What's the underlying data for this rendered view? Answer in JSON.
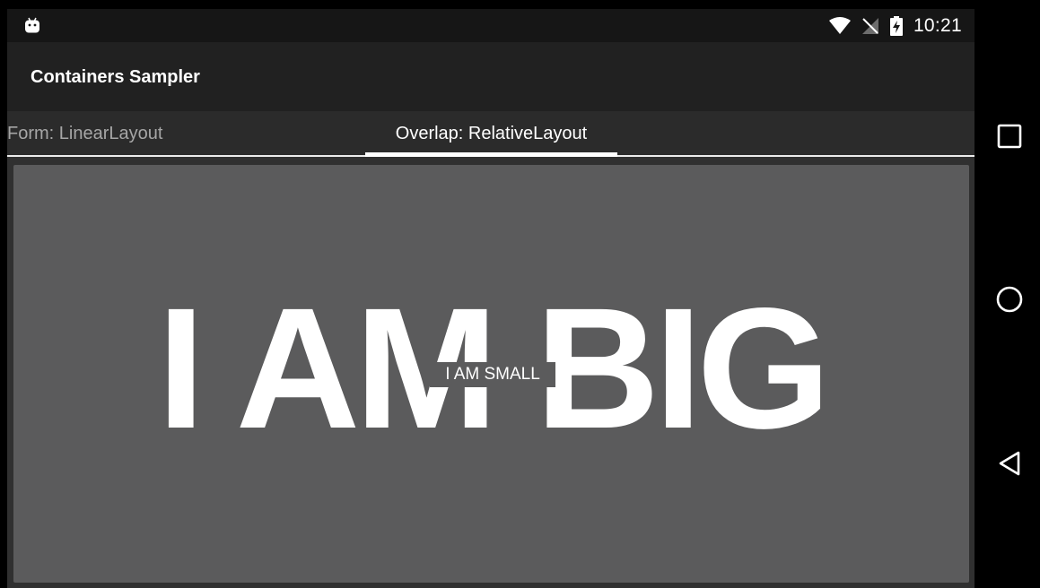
{
  "status_bar": {
    "time": "10:21",
    "icons": [
      "android-debug-icon",
      "wifi-icon",
      "no-sim-icon",
      "battery-charging-icon"
    ]
  },
  "app_bar": {
    "title": "Containers Sampler"
  },
  "tabs": [
    {
      "label": "Form: LinearLayout",
      "selected": false
    },
    {
      "label": "Overlap: RelativeLayout",
      "selected": true
    }
  ],
  "content": {
    "big_label": "I AM BIG",
    "small_label": "I AM SMALL"
  },
  "nav_bar": {
    "icons": [
      "recents-square-icon",
      "home-circle-icon",
      "back-triangle-icon"
    ]
  },
  "colors": {
    "status_bar": "#161616",
    "app_bar": "#212121",
    "tab_bar": "#2b2b2b",
    "content_bg": "#5b5b5c",
    "text_primary": "#ffffff",
    "text_inactive": "#a6a6a6"
  }
}
